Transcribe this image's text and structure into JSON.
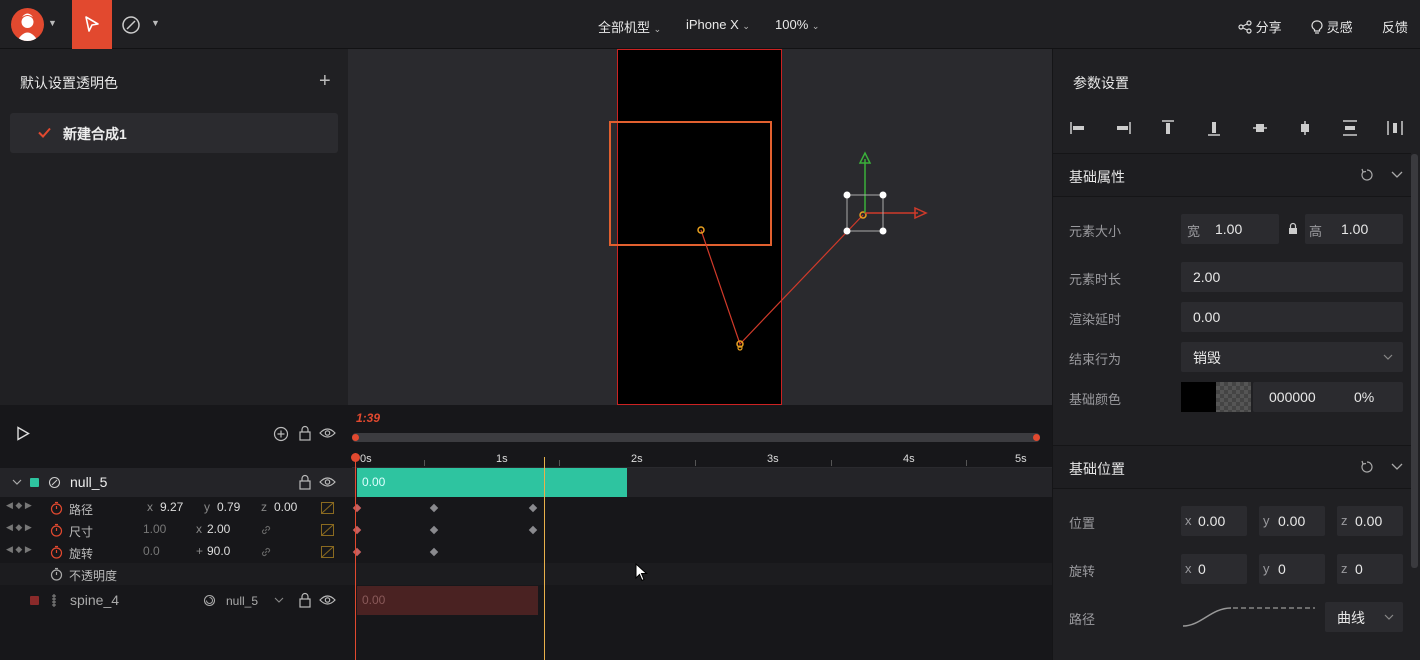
{
  "toolbar": {
    "device_group": "全部机型",
    "device": "iPhone X",
    "zoom": "100%",
    "share": "分享",
    "inspiration": "灵感",
    "feedback": "反馈"
  },
  "left_panel": {
    "title": "默认设置透明色",
    "compositions": [
      {
        "label": "新建合成1",
        "checked": true
      }
    ]
  },
  "right_panel": {
    "title": "参数设置",
    "align_icons": [
      "align-left-icon",
      "align-right-icon",
      "align-top-icon",
      "align-bottom-icon",
      "align-vcenter-icon",
      "align-hcenter-icon",
      "distribute-v-icon",
      "distribute-h-icon"
    ],
    "basic_props": {
      "title": "基础属性",
      "size_label": "元素大小",
      "width_label": "宽",
      "width": "1.00",
      "height_label": "高",
      "height": "1.00",
      "duration_label": "元素时长",
      "duration": "2.00",
      "delay_label": "渲染延时",
      "delay": "0.00",
      "end_label": "结束行为",
      "end_value": "销毁",
      "color_label": "基础颜色",
      "color_hex": "000000",
      "color_opacity": "0%"
    },
    "basic_position": {
      "title": "基础位置",
      "pos_label": "位置",
      "px_label": "x",
      "px": "0.00",
      "py_label": "y",
      "py": "0.00",
      "pz_label": "z",
      "pz": "0.00",
      "rot_label": "旋转",
      "rx_label": "x",
      "rx": "0",
      "ry_label": "y",
      "ry": "0",
      "rz_label": "z",
      "rz": "0",
      "path_label": "路径",
      "path_value": "曲线"
    }
  },
  "timeline": {
    "current_time": "1:39",
    "ruler": [
      "0s",
      "1s",
      "2s",
      "3s",
      "4s",
      "5s"
    ],
    "layers": [
      {
        "name": "null_5",
        "color": "#2ec4a0",
        "clip_value": "0.00",
        "props": [
          {
            "label": "路径",
            "a_label": "x",
            "a": "9.27",
            "b_label": "y",
            "b": "0.79",
            "c_label": "z",
            "c": "0.00"
          },
          {
            "label": "尺寸",
            "a": "1.00",
            "b_label": "x",
            "b": "2.00"
          },
          {
            "label": "旋转",
            "a": "0.0",
            "b_label": "+",
            "b": "90.0"
          },
          {
            "label": "不透明度"
          }
        ]
      },
      {
        "name": "spine_4",
        "color": "#8a2a2a",
        "parent": "null_5",
        "clip_value": "0.00"
      }
    ]
  },
  "colors": {
    "accent": "#e2492f",
    "teal": "#2ec4a0",
    "playhead": "#e8b04a"
  }
}
